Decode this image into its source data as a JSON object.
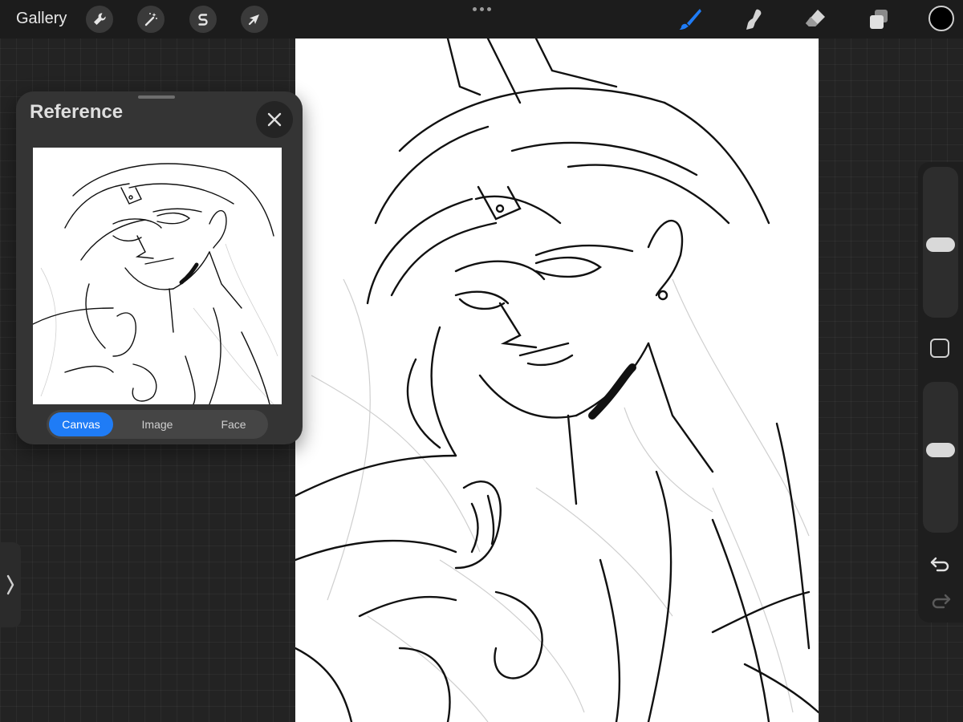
{
  "topbar": {
    "gallery_label": "Gallery",
    "left_tools": [
      {
        "name": "actions",
        "icon": "wrench-icon"
      },
      {
        "name": "adjustments",
        "icon": "magic-wand-icon"
      },
      {
        "name": "selection",
        "icon": "selection-s-icon"
      },
      {
        "name": "transform",
        "icon": "arrow-cursor-icon"
      }
    ],
    "right_tools": [
      {
        "name": "brush",
        "icon": "brush-icon",
        "active": true
      },
      {
        "name": "smudge",
        "icon": "smudge-finger-icon",
        "active": false
      },
      {
        "name": "eraser",
        "icon": "eraser-icon",
        "active": false
      },
      {
        "name": "layers",
        "icon": "layers-icon",
        "active": false
      }
    ],
    "current_color": "#000000",
    "accent_color": "#1f7cf6"
  },
  "sidebar": {
    "brush_size_icon": "brush-size-slider",
    "opacity_icon": "opacity-slider",
    "modify_icon": "modify-square-icon",
    "undo_icon": "undo-arrow-icon",
    "redo_icon": "redo-arrow-icon"
  },
  "reference_panel": {
    "title": "Reference",
    "close_icon": "close-icon",
    "tabs": [
      {
        "label": "Canvas",
        "active": true
      },
      {
        "label": "Image",
        "active": false
      },
      {
        "label": "Face",
        "active": false
      }
    ]
  },
  "left_handle_icon": "chevron-right-icon"
}
